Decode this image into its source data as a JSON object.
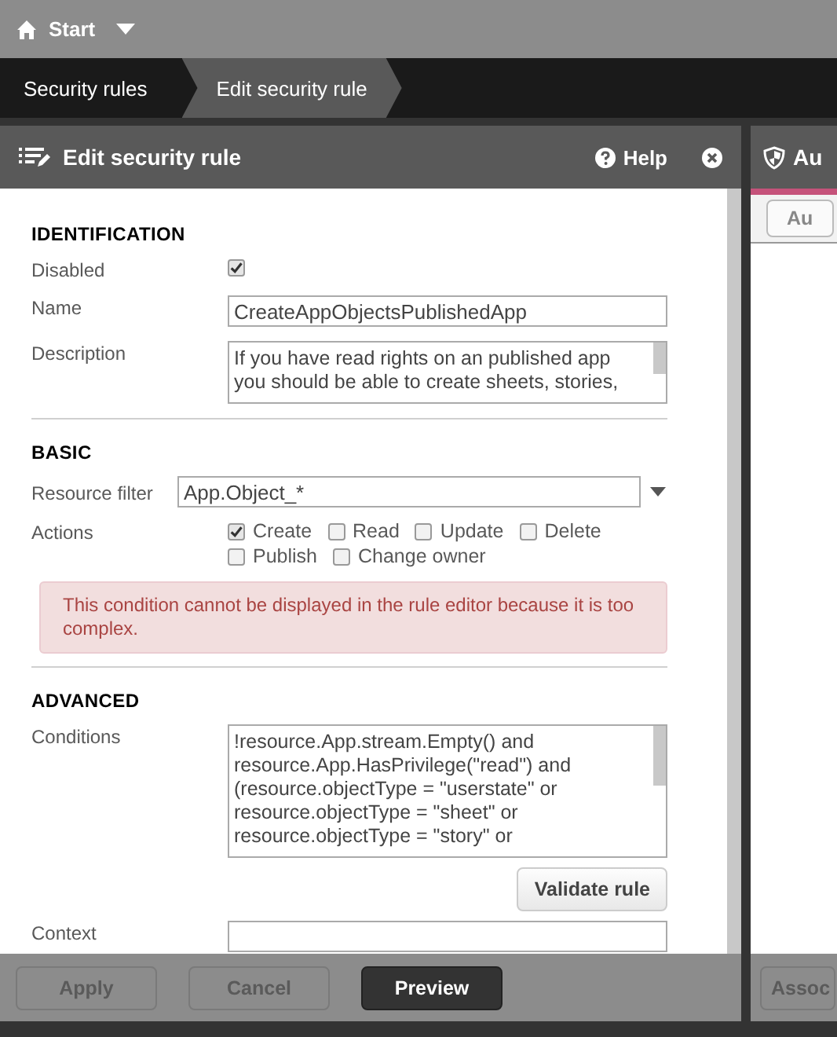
{
  "top_bar": {
    "title": "Start"
  },
  "breadcrumbs": [
    {
      "label": "Security rules",
      "selected": false
    },
    {
      "label": "Edit security rule",
      "selected": true
    }
  ],
  "panel": {
    "title": "Edit security rule",
    "help": "Help",
    "identification": {
      "heading": "IDENTIFICATION",
      "disabled": {
        "label": "Disabled",
        "checked": true
      },
      "name": {
        "label": "Name",
        "value": "CreateAppObjectsPublishedApp"
      },
      "description": {
        "label": "Description",
        "value": "If you have read rights on an published app\nyou should be able to create sheets, stories,"
      }
    },
    "basic": {
      "heading": "BASIC",
      "resource_filter": {
        "label": "Resource filter",
        "value": "App.Object_*"
      },
      "actions": {
        "label": "Actions",
        "options": [
          {
            "label": "Create",
            "checked": true
          },
          {
            "label": "Read",
            "checked": false
          },
          {
            "label": "Update",
            "checked": false
          },
          {
            "label": "Delete",
            "checked": false
          },
          {
            "label": "Publish",
            "checked": false
          },
          {
            "label": "Change owner",
            "checked": false
          }
        ]
      },
      "alert": "This condition cannot be displayed in the rule editor because it is too complex."
    },
    "advanced": {
      "heading": "ADVANCED",
      "conditions": {
        "label": "Conditions",
        "value": "!resource.App.stream.Empty() and\nresource.App.HasPrivilege(\"read\") and\n(resource.objectType = \"userstate\" or\nresource.objectType = \"sheet\" or\nresource.objectType = \"story\" or"
      },
      "validate_button": "Validate rule",
      "context": {
        "label": "Context"
      }
    },
    "footer_buttons": [
      {
        "label": "Apply",
        "disabled": true
      },
      {
        "label": "Cancel",
        "disabled": true
      },
      {
        "label": "Preview",
        "disabled": false
      }
    ]
  },
  "side_panel": {
    "title": "Au",
    "tab_button": "Au",
    "footer_button": "Assoc"
  }
}
